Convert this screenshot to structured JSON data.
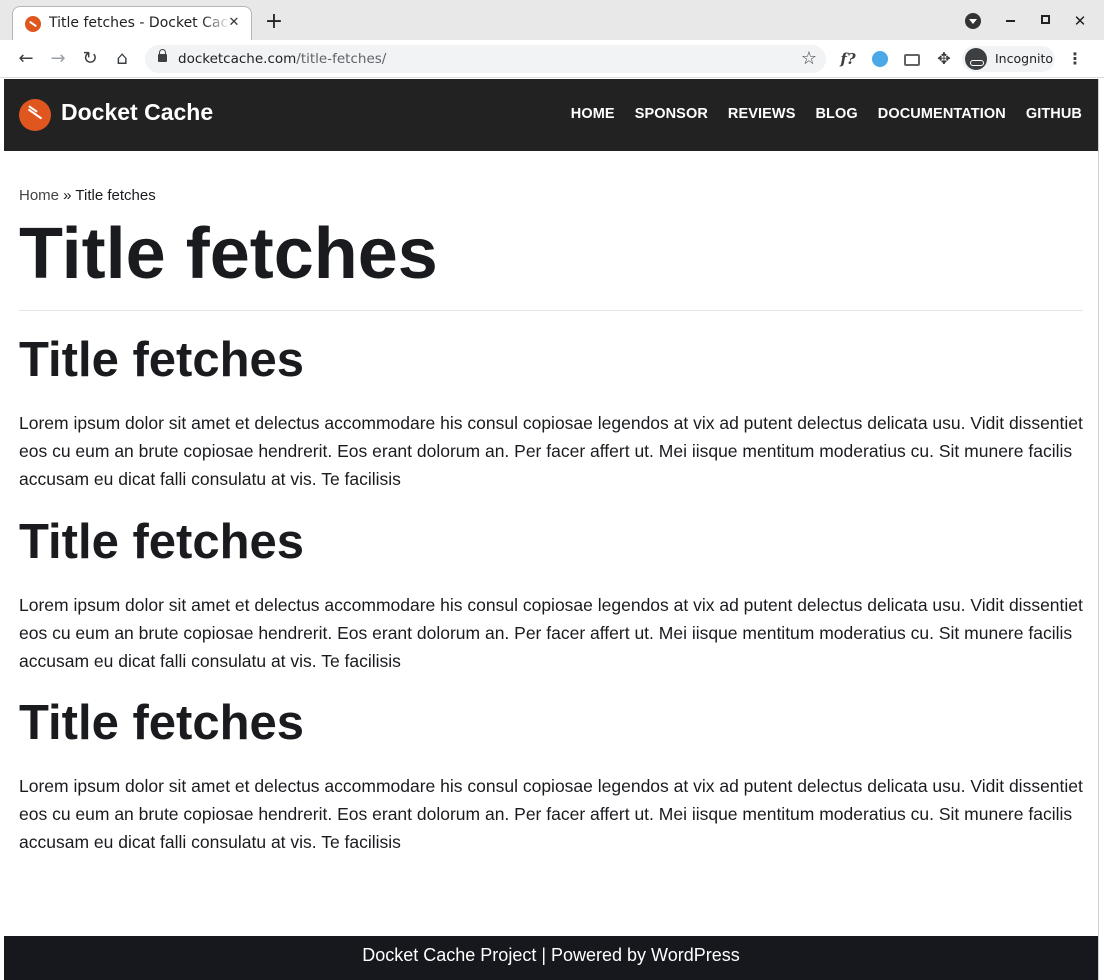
{
  "browser": {
    "tab_title": "Title fetches - Docket Cache",
    "tab_close": "✕",
    "new_tab": "+",
    "url_host": "docketcache.com",
    "url_path": "/title-fetches/",
    "incognito_label": "Incognito",
    "extension_label": "f?"
  },
  "site": {
    "name": "Docket Cache",
    "nav": [
      "HOME",
      "SPONSOR",
      "REVIEWS",
      "BLOG",
      "DOCUMENTATION",
      "GITHUB"
    ],
    "accent": "#e0561f",
    "header_bg": "#222222"
  },
  "breadcrumb": {
    "home": "Home",
    "separator": " » ",
    "current": "Title fetches"
  },
  "page": {
    "title": "Title fetches",
    "sections": [
      {
        "heading": "Title fetches",
        "text": "Lorem ipsum dolor sit amet et delectus accommodare his consul copiosae legendos at vix ad putent delectus delicata usu. Vidit dissentiet eos cu eum an brute copiosae hendrerit. Eos erant dolorum an. Per facer affert ut. Mei iisque mentitum moderatius cu. Sit munere facilis accusam eu dicat falli consulatu at vis. Te facilisis"
      },
      {
        "heading": "Title fetches",
        "text": "Lorem ipsum dolor sit amet et delectus accommodare his consul copiosae legendos at vix ad putent delectus delicata usu. Vidit dissentiet eos cu eum an brute copiosae hendrerit. Eos erant dolorum an. Per facer affert ut. Mei iisque mentitum moderatius cu. Sit munere facilis accusam eu dicat falli consulatu at vis. Te facilisis"
      },
      {
        "heading": "Title fetches",
        "text": "Lorem ipsum dolor sit amet et delectus accommodare his consul copiosae legendos at vix ad putent delectus delicata usu. Vidit dissentiet eos cu eum an brute copiosae hendrerit. Eos erant dolorum an. Per facer affert ut. Mei iisque mentitum moderatius cu. Sit munere facilis accusam eu dicat falli consulatu at vis. Te facilisis"
      }
    ]
  },
  "footer": {
    "text": "Docket Cache Project | Powered by WordPress"
  }
}
